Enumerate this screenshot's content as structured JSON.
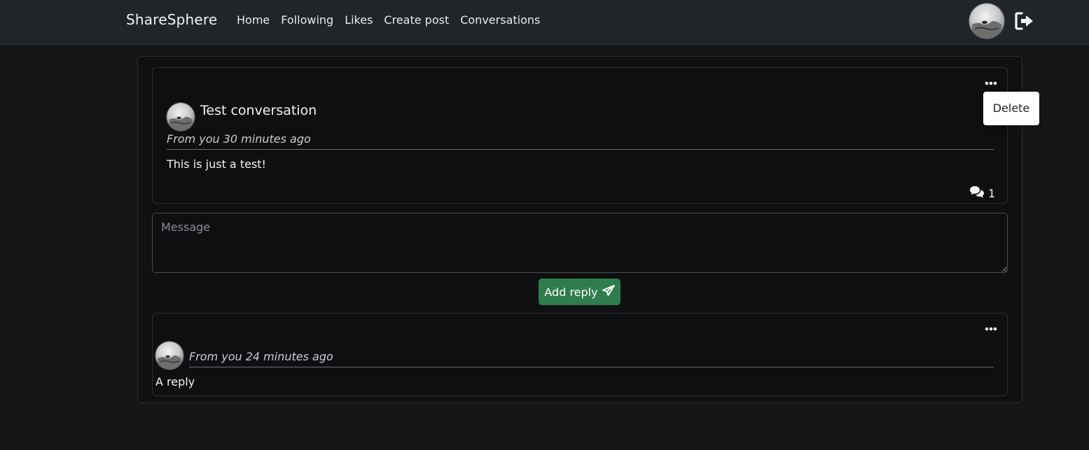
{
  "nav": {
    "brand": "ShareSphere",
    "links": [
      "Home",
      "Following",
      "Likes",
      "Create post",
      "Conversations"
    ]
  },
  "conversation": {
    "title": "Test conversation",
    "meta": "From you 30 minutes ago",
    "body": "This is just a test!",
    "reply_count": "1"
  },
  "dropdown": {
    "delete_label": "Delete"
  },
  "reply_form": {
    "placeholder": "Message",
    "submit_label": "Add reply"
  },
  "replies": [
    {
      "meta": "From you 24 minutes ago",
      "body": "A reply"
    }
  ],
  "colors": {
    "accent": "#2f7d4c",
    "background": "#141517",
    "navbar": "#212429"
  }
}
